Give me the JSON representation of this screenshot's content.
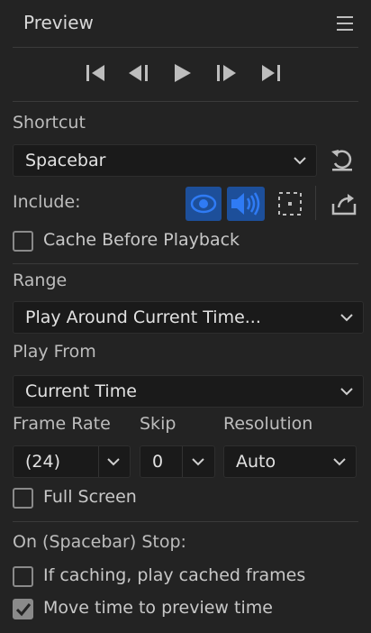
{
  "panel": {
    "title": "Preview",
    "menu_icon": "hamburger-menu-icon"
  },
  "transport": {
    "buttons": [
      "go-to-first-frame-icon",
      "previous-frame-icon",
      "play-icon",
      "next-frame-icon",
      "go-to-last-frame-icon"
    ]
  },
  "shortcut": {
    "label": "Shortcut",
    "value": "Spacebar",
    "reset_icon": "reset-icon"
  },
  "include": {
    "label": "Include:",
    "video_toggle": true,
    "audio_toggle": true,
    "overlays_toggle": false,
    "export_icon": "export-icon"
  },
  "cache_before_playback": {
    "label": "Cache Before Playback",
    "checked": false
  },
  "range": {
    "label": "Range",
    "value": "Play Around Current Time..."
  },
  "play_from": {
    "label": "Play From",
    "value": "Current Time"
  },
  "frame_rate": {
    "label": "Frame Rate",
    "value": "(24)"
  },
  "skip": {
    "label": "Skip",
    "value": "0"
  },
  "resolution": {
    "label": "Resolution",
    "value": "Auto"
  },
  "full_screen": {
    "label": "Full Screen",
    "checked": false
  },
  "on_stop": {
    "label": "On (Spacebar) Stop:",
    "if_caching": {
      "label": "If caching, play cached frames",
      "checked": false
    },
    "move_time": {
      "label": "Move time to preview time",
      "checked": true
    }
  },
  "colors": {
    "background": "#232323",
    "field": "#1a1a1a",
    "accent": "#2f7bf5",
    "toggle_bg": "#1d4f9a"
  }
}
